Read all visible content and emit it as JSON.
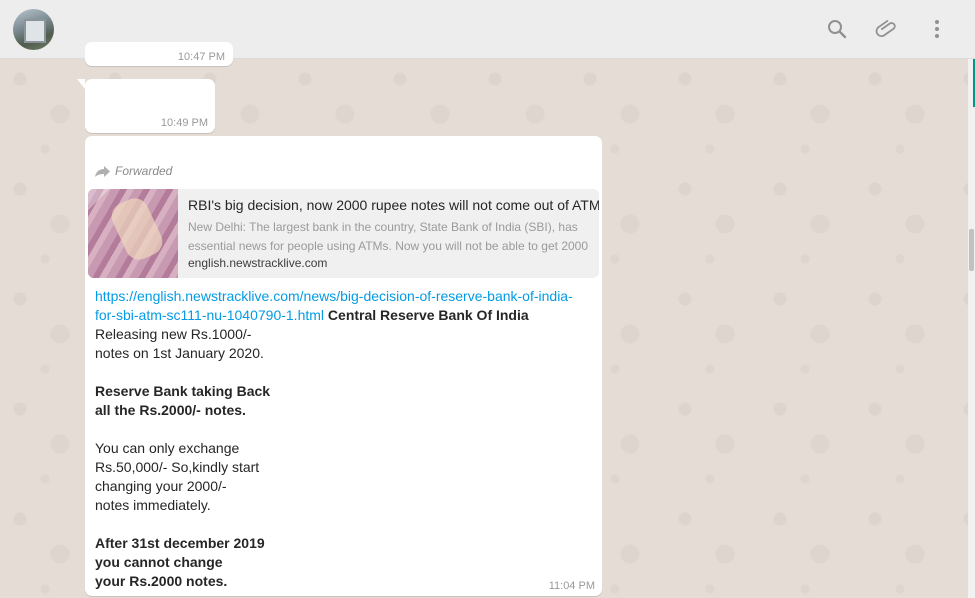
{
  "header": {
    "search_icon": "search-icon",
    "attach_icon": "paperclip-icon",
    "menu_icon": "more-vertical-icon"
  },
  "messages": {
    "top_time": "10:47 PM",
    "second_time": "10:49 PM",
    "main": {
      "forwarded_label": "Forwarded",
      "preview": {
        "title": "RBI's big decision, now 2000 rupee notes will not come out of ATM",
        "description": "New Delhi: The largest bank in the country, State Bank of India (SBI), has essential news for people using ATMs. Now you will not be able to get 2000",
        "domain": "english.newstracklive.com"
      },
      "link_line1": "https://english.newstracklive.com/news/big-decision-of-reserve-bank-of-india-",
      "link_line2": "for-sbi-atm-sc111-nu-1040790-1.html",
      "bold_heading": "Central Reserve Bank Of India",
      "p1_line1": "Releasing new Rs.1000/-",
      "p1_line2": "notes on 1st January 2020.",
      "p2_line1": "Reserve Bank taking Back",
      "p2_line2": "all the Rs.2000/- notes.",
      "p3_line1": "You can only exchange",
      "p3_line2": "Rs.50,000/- So,kindly start",
      "p3_line3": "changing your 2000/-",
      "p3_line4": "notes immediately.",
      "p4_line1": "After 31st december 2019",
      "p4_line2": "you cannot change",
      "p4_line3": "your Rs.2000 notes.",
      "time": "11:04 PM"
    }
  }
}
